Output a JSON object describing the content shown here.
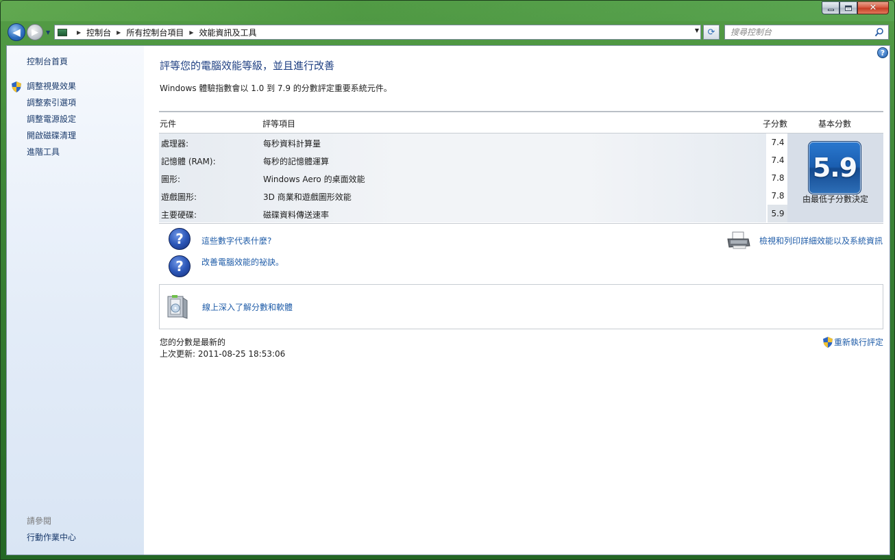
{
  "window": {
    "caption_buttons": {
      "minimize": "",
      "maximize": "",
      "close": "✕"
    }
  },
  "address_bar": {
    "crumbs": [
      "控制台",
      "所有控制台項目",
      "效能資訊及工具"
    ]
  },
  "search": {
    "placeholder": "搜尋控制台"
  },
  "sidebar": {
    "home": "控制台首頁",
    "tasks": [
      "調整視覺效果",
      "調整索引選項",
      "調整電源設定",
      "開啟磁碟清理",
      "進階工具"
    ],
    "see_also_title": "請參閱",
    "see_also": [
      "行動作業中心"
    ]
  },
  "main": {
    "title": "評等您的電腦效能等級，並且進行改善",
    "subtitle": "Windows 體驗指數會以 1.0 到 7.9 的分數評定重要系統元件。",
    "table": {
      "headers": {
        "component": "元件",
        "rating": "評等項目",
        "subscore": "子分數",
        "base": "基本分數"
      },
      "rows": [
        {
          "component": "處理器:",
          "description": "每秒資料計算量",
          "score": "7.4"
        },
        {
          "component": "記憶體 (RAM):",
          "description": "每秒的記憶體運算",
          "score": "7.4"
        },
        {
          "component": "圖形:",
          "description": "Windows Aero 的桌面效能",
          "score": "7.8"
        },
        {
          "component": "遊戲圖形:",
          "description": "3D 商業和遊戲圖形效能",
          "score": "7.8"
        },
        {
          "component": "主要硬碟:",
          "description": "磁碟資料傳送速率",
          "score": "5.9"
        }
      ],
      "base_score": "5.9",
      "base_caption": "由最低子分數決定"
    },
    "links": {
      "what_numbers": "這些數字代表什麼?",
      "tips": "改善電腦效能的祕訣。",
      "print_details": "檢視和列印詳細效能以及系統資訊",
      "learn_online": "線上深入了解分數和軟體"
    },
    "status": {
      "current": "您的分數是最新的",
      "last_update": "上次更新: 2011-08-25 18:53:06",
      "rerun": "重新執行評定"
    }
  },
  "colors": {
    "link": "#1f5ca8",
    "title": "#1e3f82",
    "badge": "#1a5eb0"
  }
}
